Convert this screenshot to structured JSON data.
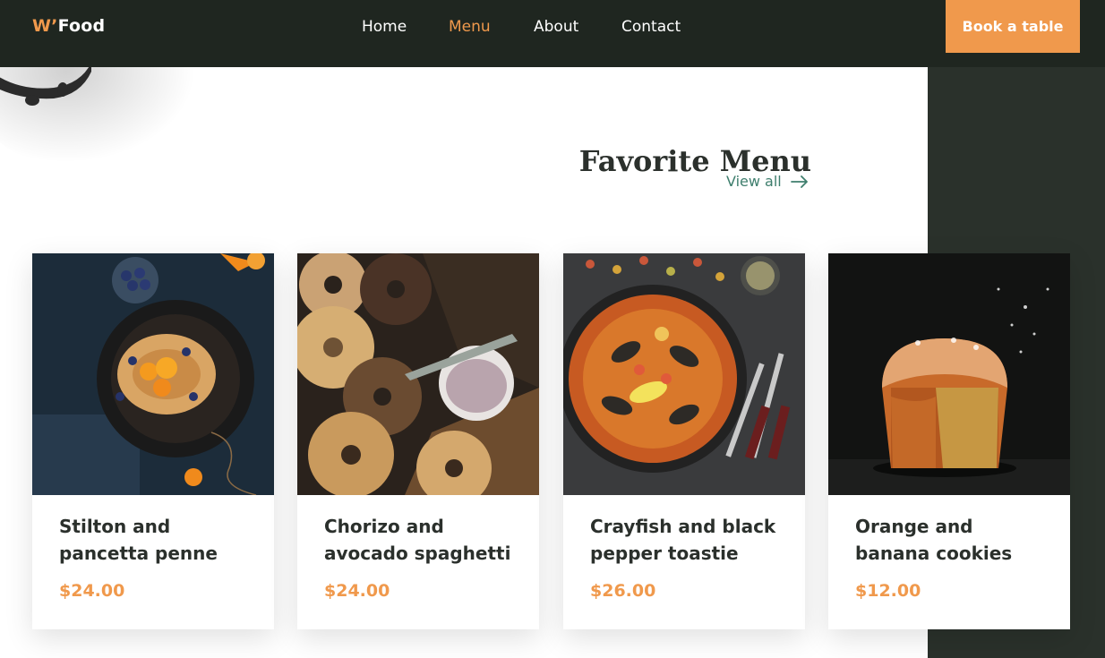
{
  "brand": {
    "logo_prefix": "W’",
    "logo_suffix": "Food",
    "accent_color": "#f0994c"
  },
  "nav": {
    "items": [
      {
        "label": "Home",
        "active": false
      },
      {
        "label": "Menu",
        "active": true
      },
      {
        "label": "About",
        "active": false
      },
      {
        "label": "Contact",
        "active": false
      }
    ]
  },
  "header": {
    "cta_label": "Book a table"
  },
  "section": {
    "title": "Favorite Menu",
    "view_all_label": "View all"
  },
  "menu_items": [
    {
      "title": "Stilton and pancetta penne",
      "price": "$24.00",
      "image_icon": "pancake-skillet-photo"
    },
    {
      "title": "Chorizo and avocado spaghetti",
      "price": "$24.00",
      "image_icon": "bagels-photo"
    },
    {
      "title": "Crayfish and black pepper toastie",
      "price": "$26.00",
      "image_icon": "paella-photo"
    },
    {
      "title": "Orange and banana cookies",
      "price": "$12.00",
      "image_icon": "panettone-photo"
    }
  ],
  "colors": {
    "header_bg": "#1f2620",
    "panel_bg": "#2a312b",
    "link_green": "#3e7e6d",
    "text_dark": "#2b302c"
  }
}
